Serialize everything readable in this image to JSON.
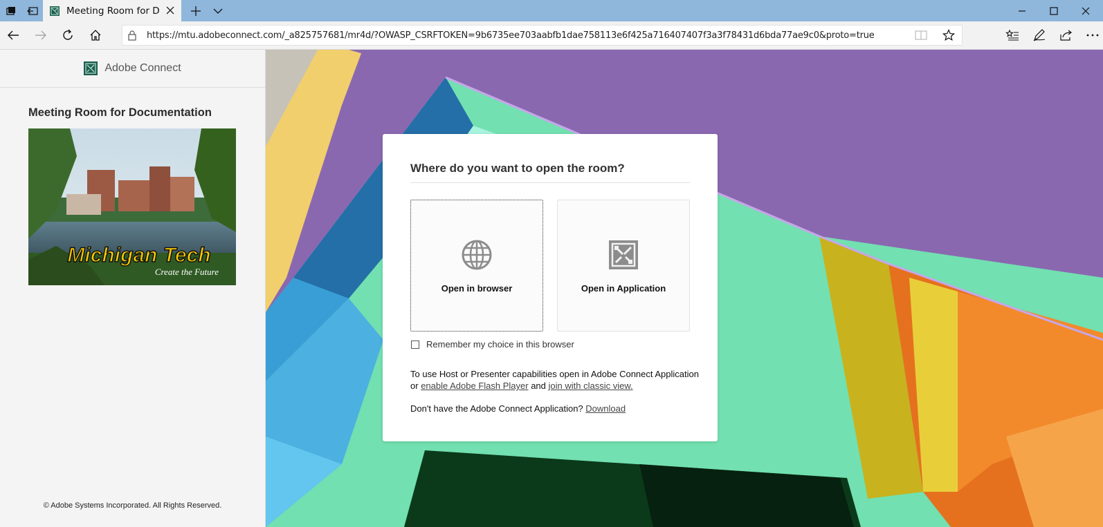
{
  "browser": {
    "tab_title": "Meeting Room for Documentation",
    "url": "https://mtu.adobeconnect.com/_a825757681/mr4d/?OWASP_CSRFTOKEN=9b6735ee703aabfb1dae758113e6f425a716407407f3a3f78431d6bda77ae9c0&proto=true",
    "icons": [
      "tab-actions-icon",
      "set-aside-tabs-icon",
      "new-tab-icon",
      "tab-list-icon",
      "minimize-icon",
      "maximize-icon",
      "close-window-icon",
      "back-icon",
      "forward-icon",
      "refresh-icon",
      "home-icon",
      "lock-icon",
      "reading-view-icon",
      "favorite-star-icon",
      "favorites-list-icon",
      "pen-icon",
      "share-icon",
      "more-icon"
    ]
  },
  "sidebar": {
    "brand_name": "Adobe Connect",
    "room_title": "Meeting Room for Documentation",
    "image_caption_title": "Michigan Tech",
    "image_caption_tagline": "Create the Future",
    "copyright": "© Adobe Systems Incorporated. All Rights Reserved."
  },
  "dialog": {
    "title": "Where do you want to open the room?",
    "open_browser_label": "Open in browser",
    "open_app_label": "Open in Application",
    "remember_label": "Remember my choice in this browser",
    "remember_checked": false,
    "info_prefix": "To use Host or Presenter capabilities open in Adobe Connect Application or",
    "flash_link": "enable Adobe Flash Player",
    "info_and": "and",
    "classic_link": "join with classic view.",
    "download_prefix": "Don't have the Adobe Connect Application?",
    "download_link": "Download"
  },
  "colors": {
    "titlebar": "#8fb6db",
    "bg_purple": "#8a68b0",
    "bg_green": "#6fe1ae",
    "bg_blue": "#3a9ed6",
    "bg_yellow": "#e8cf3a",
    "bg_orange": "#e5711e"
  }
}
